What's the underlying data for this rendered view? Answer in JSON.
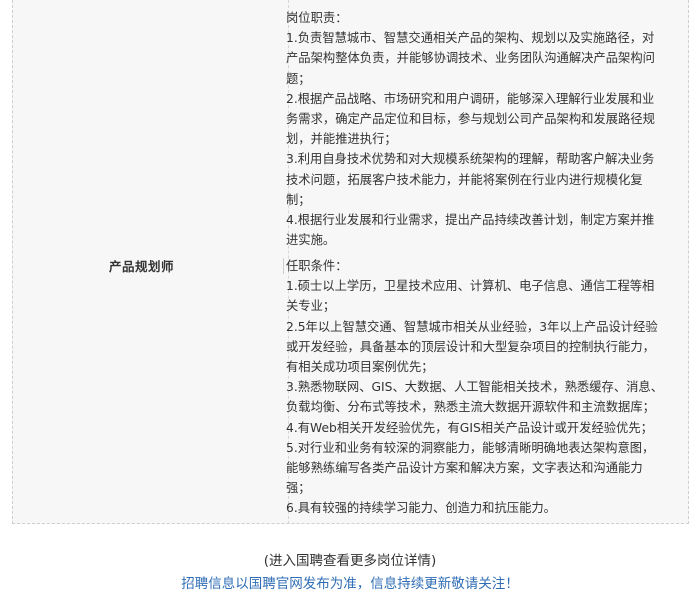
{
  "job": {
    "name": "产品规划师",
    "duties": [
      "岗位职责：",
      "1.负责智慧城市、智慧交通相关产品的架构、规划以及实施路径，对",
      "产品架构整体负责，并能够协调技术、业务团队沟通解决产品架构问",
      "题；",
      "2.根据产品战略、市场研究和用户调研，能够深入理解行业发展和业",
      "务需求，确定产品定位和目标，参与规划公司产品架构和发展路径规",
      "划，并能推进执行；",
      "3.利用自身技术优势和对大规模系统架构的理解，帮助客户解决业务",
      "技术问题，拓展客户技术能力，并能将案例在行业内进行规模化复",
      "制；",
      "4.根据行业发展和行业需求，提出产品持续改善计划，制定方案并推",
      "进实施。"
    ],
    "requirements": [
      "任职条件：",
      "1.硕士以上学历，卫星技术应用、计算机、电子信息、通信工程等相",
      "关专业；",
      "2.5年以上智慧交通、智慧城市相关从业经验，3年以上产品设计经验",
      "或开发经验，具备基本的顶层设计和大型复杂项目的控制执行能力，",
      "有相关成功项目案例优先；",
      "3.熟悉物联网、GIS、大数据、人工智能相关技术，熟悉缓存、消息、",
      "负载均衡、分布式等技术，熟悉主流大数据开源软件和主流数据库；",
      "4.有Web相关开发经验优先，有GIS相关产品设计或开发经验优先；",
      "5.对行业和业务有较深的洞察能力，能够清晰明确地表达架构意图，",
      "能够熟练编写各类产品设计方案和解决方案，文字表达和沟通能力",
      "强；",
      "6.具有较强的持续学习能力、创造力和抗压能力。"
    ]
  },
  "footer": {
    "more_link": "(进入国聘查看更多岗位详情)",
    "note": "招聘信息以国聘官网发布为准，信息持续更新敬请关注！"
  },
  "colors": {
    "table_bg": "#f7f7f7",
    "text": "#333333",
    "note_link": "#2f6eb5"
  }
}
